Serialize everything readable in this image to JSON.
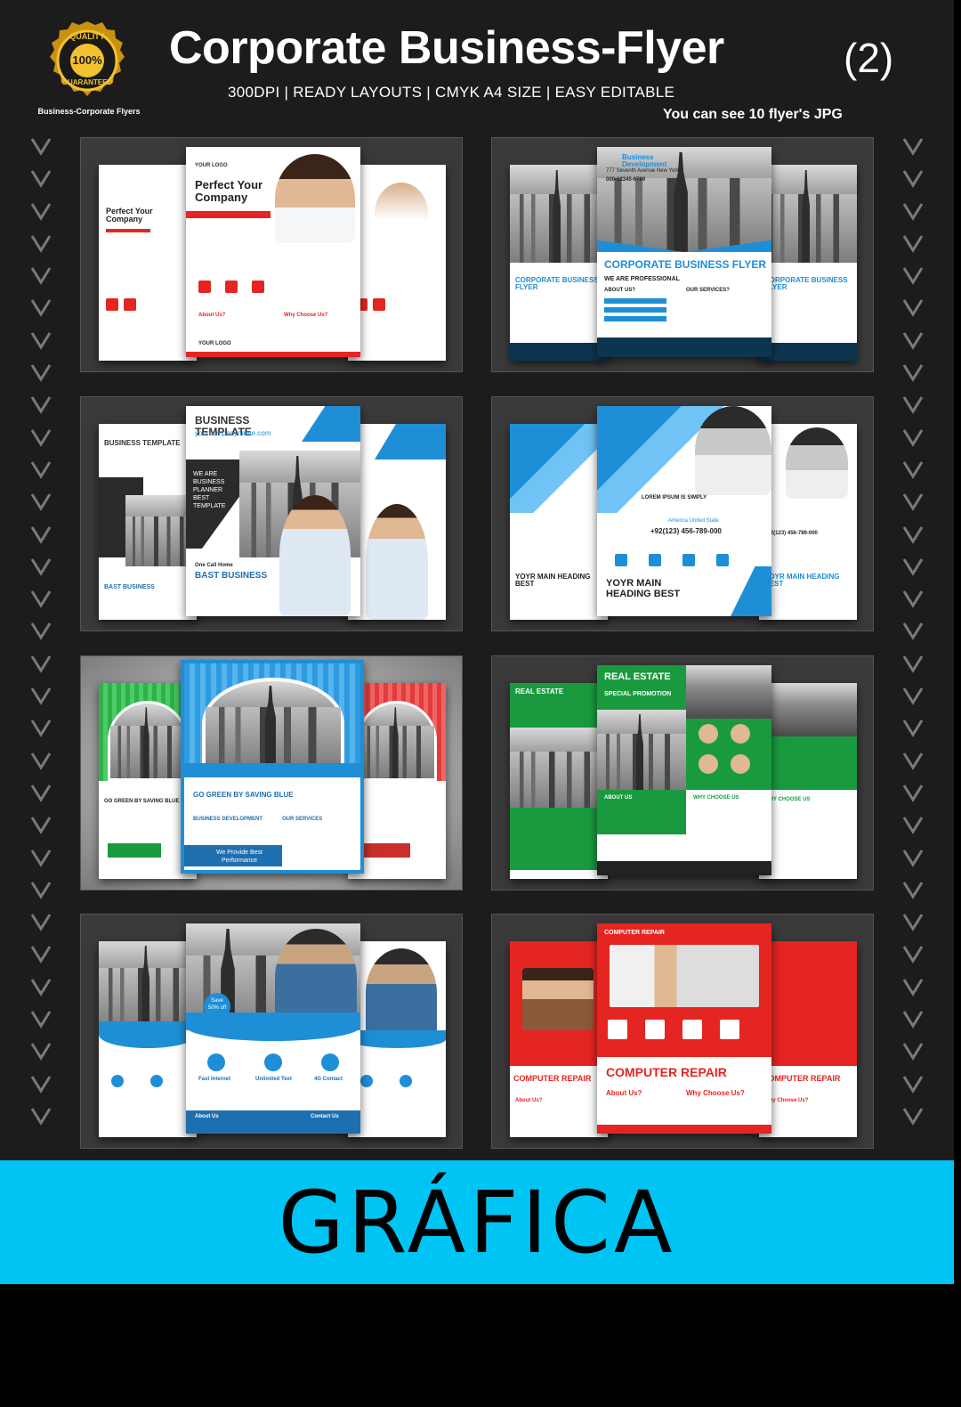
{
  "header": {
    "badge_top": "QUALITY",
    "badge_center": "100%",
    "badge_bottom": "GUARANTEED",
    "badge_caption": "Business-Corporate Flyers",
    "title": "Corporate Business-Flyer",
    "title_number": "(2)",
    "subtitle": "300DPI | READY LAYOUTS | CMYK  A4 SIZE | EASY EDITABLE",
    "note": "You can see 10 flyer's JPG"
  },
  "flyers": {
    "p1": {
      "title": "Perfect Your Company",
      "logo": "YOUR LOGO",
      "about": "About Us?",
      "why": "Why Choose Us?",
      "accent": "#e52521"
    },
    "p2": {
      "title": "CORPORATE BUSINESS FLYER",
      "sub": "WE ARE PROFESSIONAL",
      "top": "Business Development",
      "address": "777 Seventh Avenue New York",
      "phone": "000-12345-6789",
      "about": "ABOUT US?",
      "services": "OUR SERVICES?",
      "accent": "#1e8fd6"
    },
    "p3": {
      "title": "BUSINESS TEMPLATE",
      "url": "yourcompanyname.com",
      "list": "WE ARE BUSINESS PLANNER BEST TEMPLATE",
      "cta": "BAST BUSINESS",
      "cta_sub": "One Call Home",
      "accent": "#1e8fd6"
    },
    "p4": {
      "heading": "YOYR MAIN HEADING BEST",
      "phone": "+92(123) 456-789-000",
      "location": "America United State",
      "lorem": "LOREM IPSUM IS SIMPLY",
      "accent": "#1e8fd6"
    },
    "p5": {
      "heading": "GO GREEN BY SAVING BLUE",
      "cta": "We Provide Best Performance",
      "dev": "BUSINESS DEVELOPMENT",
      "services": "OUR SERVICES",
      "accent": "#1e8fd6"
    },
    "p6": {
      "title": "REAL ESTATE",
      "promo": "SPECIAL PROMOTION",
      "about": "ABOUT US",
      "why": "WHY CHOOSE US",
      "accent": "#1a9a3f"
    },
    "p7": {
      "save": "Save 50% off",
      "items": [
        "Fast Internet",
        "Unlimited Text",
        "4G Contact"
      ],
      "about": "About Us",
      "contact": "Contact Us",
      "accent": "#1e8fd6"
    },
    "p8": {
      "title": "COMPUTER REPAIR",
      "about": "About Us?",
      "why": "Why Choose Us?",
      "accent": "#e52521"
    }
  },
  "banner": {
    "label": "GRÁFICA",
    "color": "#00c4f4"
  }
}
